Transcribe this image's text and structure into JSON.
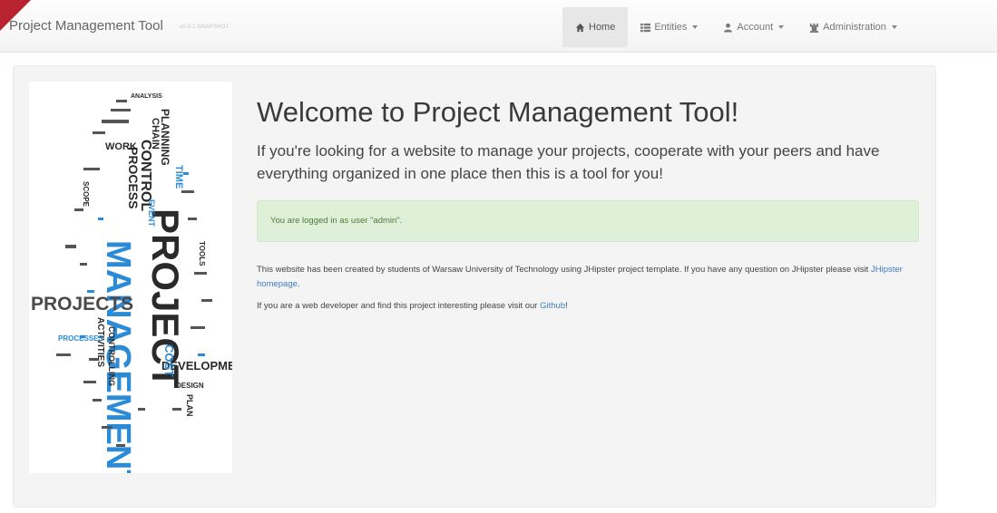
{
  "navbar": {
    "brand": "Project Management Tool",
    "version": "v0.0.1-SNAPSHOT",
    "items": [
      {
        "label": "Home",
        "icon": "home-icon",
        "active": true
      },
      {
        "label": "Entities",
        "icon": "th-list-icon",
        "dropdown": true
      },
      {
        "label": "Account",
        "icon": "user-icon",
        "dropdown": true
      },
      {
        "label": "Administration",
        "icon": "tower-icon",
        "dropdown": true
      }
    ]
  },
  "main": {
    "title": "Welcome to Project Management Tool!",
    "lead": "If you're looking for a website to manage your projects, cooperate with your peers and have everything organized in one place then this is a tool for you!",
    "alert": "You are logged in as user \"admin\".",
    "para1_text": "This website has been created by students of Warsaw University of Technology using JHipster project template. If you have any question on JHipster please visit ",
    "para1_link": "JHipster homepage",
    "para1_end": ".",
    "para2_text": "If you are a web developer and find this project interesting please visit our ",
    "para2_link": "Github",
    "para2_end": "!"
  },
  "image": {
    "words": [
      "PROJECTS",
      "MANAGEMENT",
      "PROJECT",
      "DEVELOPMENT",
      "CONTROL",
      "PROCESS",
      "WORK",
      "PLANNING",
      "ACTIVITIES",
      "PROCESSES",
      "COST",
      "TIME",
      "DESIGN",
      "PLAN",
      "CHAIN",
      "EVENT",
      "CONTROLLING",
      "SCOPE",
      "ANALYSIS",
      "TOOLS"
    ]
  },
  "colors": {
    "ribbon": "#b8232f",
    "alert_bg": "#dff0d8",
    "link": "#3d7fbf",
    "word_dark": "#2a2a2a",
    "word_blue": "#2b8bd6"
  }
}
